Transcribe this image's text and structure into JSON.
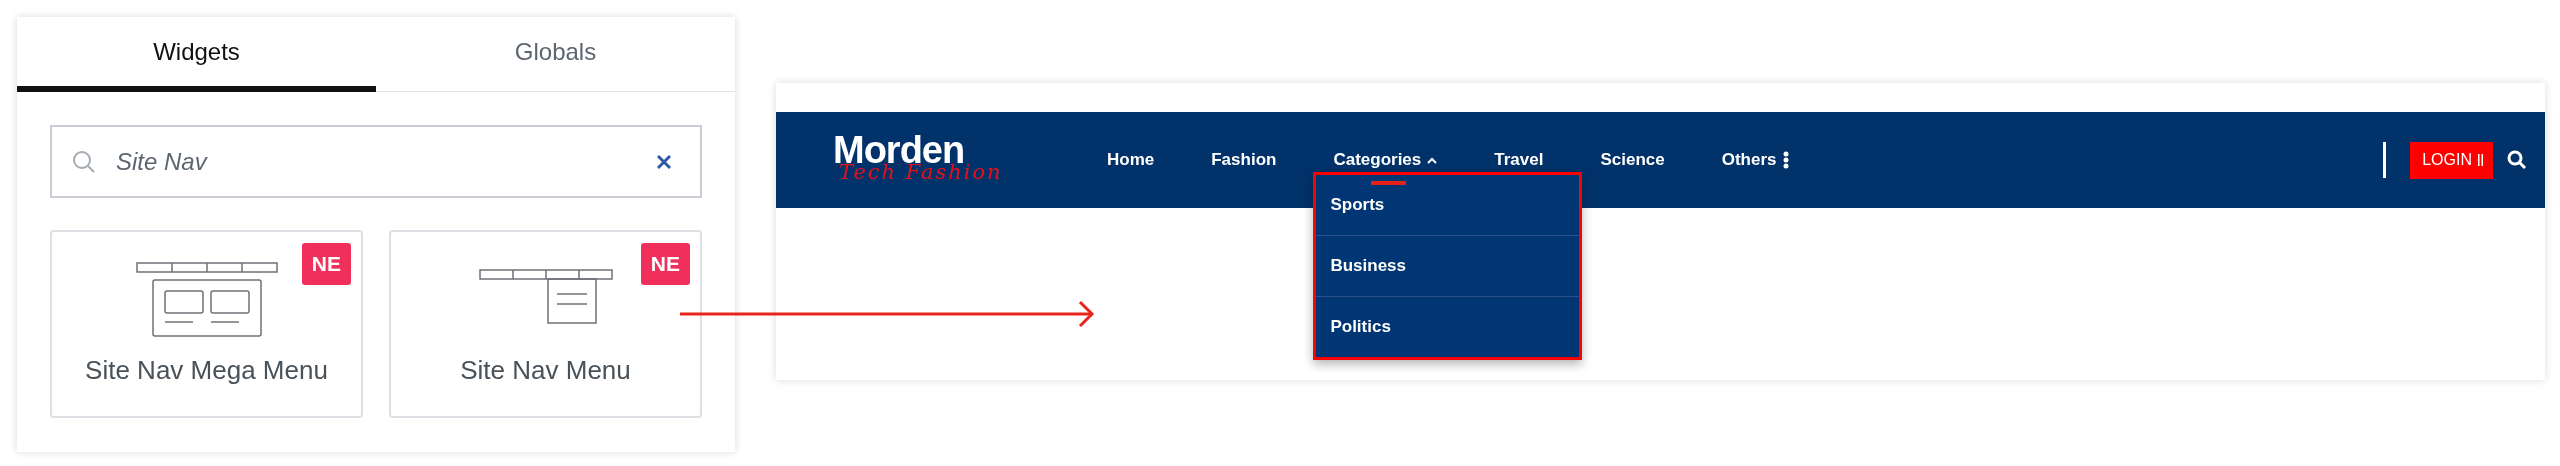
{
  "widget_panel": {
    "tabs": [
      {
        "label": "Widgets",
        "selected": true
      },
      {
        "label": "Globals",
        "selected": false
      }
    ],
    "search": {
      "value": "Site Nav"
    },
    "widgets": [
      {
        "kind": "mega",
        "title": "Site Nav Mega Menu",
        "badge": "NE"
      },
      {
        "kind": "menu",
        "title": "Site Nav Menu",
        "badge": "NE"
      }
    ]
  },
  "preview": {
    "logo": {
      "title": "Morden",
      "tagline": "Tech Fashion"
    },
    "nav": [
      {
        "kind": "link",
        "label": "Home"
      },
      {
        "kind": "link",
        "label": "Fashion"
      },
      {
        "kind": "dropdown",
        "label": "Categories",
        "expanded": true
      },
      {
        "kind": "link",
        "label": "Travel"
      },
      {
        "kind": "link",
        "label": "Science"
      },
      {
        "kind": "more",
        "label": "Others"
      }
    ],
    "dropdown": [
      "Sports",
      "Business",
      "Politics"
    ],
    "login": "LOGIN"
  }
}
